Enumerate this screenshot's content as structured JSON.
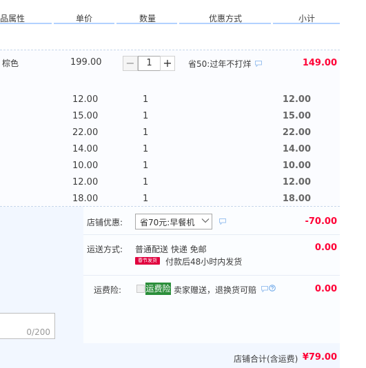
{
  "header": {
    "columns": [
      "品属性",
      "单价",
      "数量",
      "优惠方式",
      "小计"
    ]
  },
  "main_item": {
    "attribute": "棕色",
    "price": "199.00",
    "quantity": "1",
    "promo": "省50:过年不打烊",
    "subtotal": "149.00",
    "minus_label": "−",
    "plus_label": "+"
  },
  "rows": [
    {
      "price": "12.00",
      "qty": "1",
      "subtotal": "12.00"
    },
    {
      "price": "15.00",
      "qty": "1",
      "subtotal": "15.00"
    },
    {
      "price": "22.00",
      "qty": "1",
      "subtotal": "22.00"
    },
    {
      "price": "14.00",
      "qty": "1",
      "subtotal": "14.00"
    },
    {
      "price": "10.00",
      "qty": "1",
      "subtotal": "10.00"
    },
    {
      "price": "12.00",
      "qty": "1",
      "subtotal": "12.00"
    },
    {
      "price": "18.00",
      "qty": "1",
      "subtotal": "18.00"
    }
  ],
  "shop_discount": {
    "label": "店铺优惠:",
    "selected": "省70元:早餐机",
    "amount": "-70.00"
  },
  "shipping": {
    "label": "运送方式:",
    "method": "普通配送 快递 免邮",
    "badge": "春节发货",
    "note": "付款后48小时内发货",
    "amount": "0.00"
  },
  "insurance": {
    "label": "运费险:",
    "badge": "运费险",
    "description": "卖家赠送，退换货可赔",
    "amount": "0.00"
  },
  "memo": {
    "counter": "0/200"
  },
  "footer": {
    "label": "店铺合计(含运费)",
    "total": "¥79.00"
  },
  "colors": {
    "accent_red": "#ff0036",
    "header_line": "#b2d1ff",
    "insurance_green": "#2b8e3a",
    "festival_red": "#e0003e"
  }
}
